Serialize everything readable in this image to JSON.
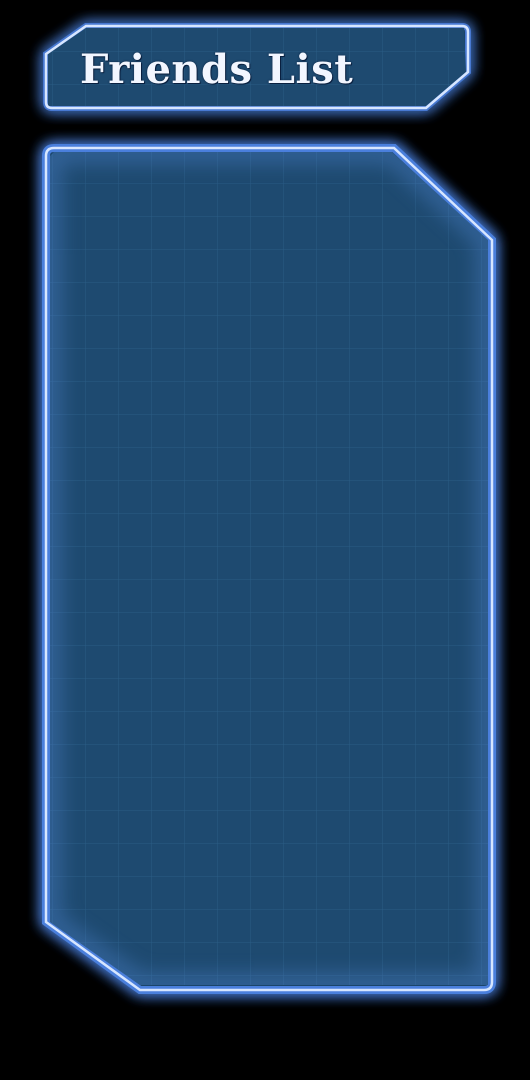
{
  "title_panel": {
    "title": "Friends List"
  },
  "friends_panel": {
    "friends": []
  },
  "colors": {
    "background": "#000000",
    "panel_fill": "#1e4a70",
    "grid_line": "#2d5f88",
    "border": "#b9d4ff",
    "glow": "#4f86e8",
    "title_text": "#f2f6ff"
  }
}
